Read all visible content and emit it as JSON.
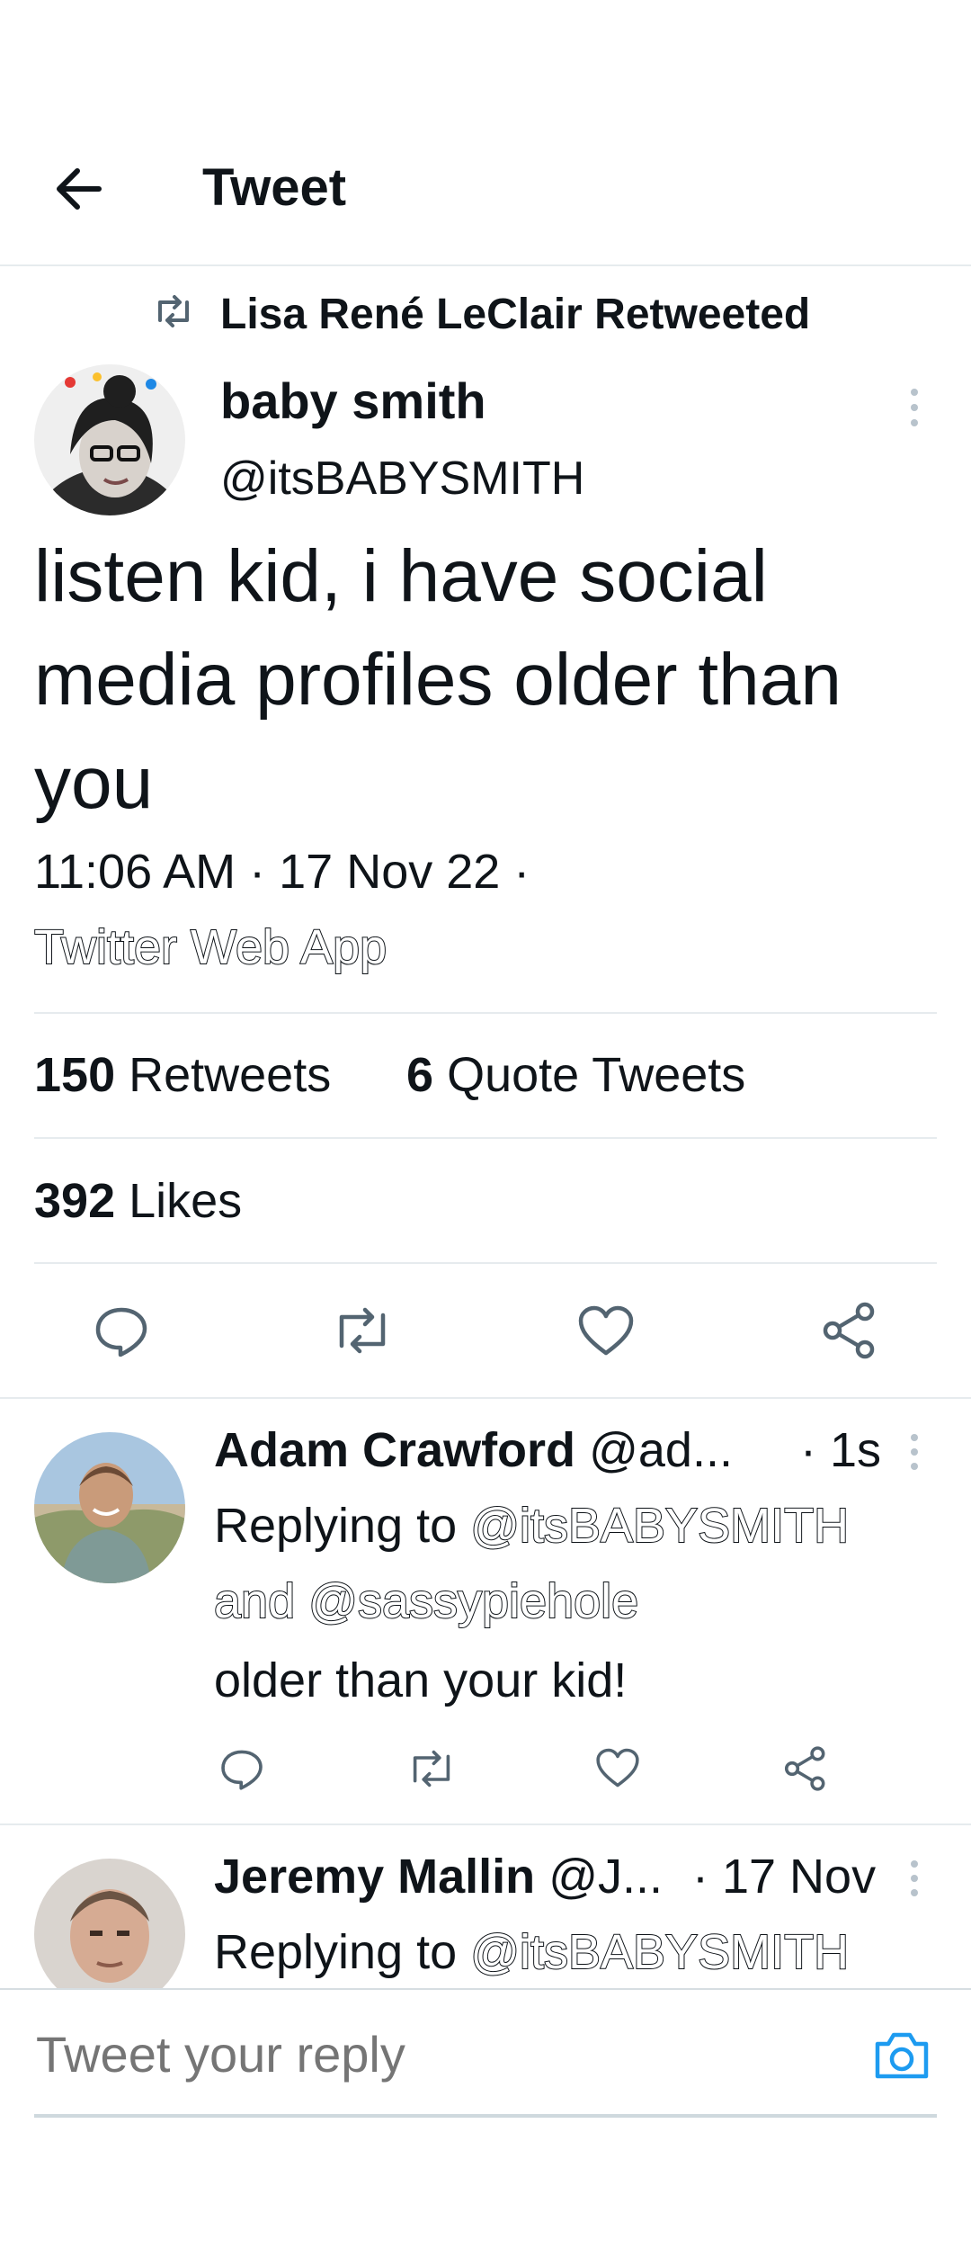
{
  "header": {
    "title": "Tweet",
    "back_icon": "arrow-left-icon"
  },
  "retweet_banner": {
    "text": "Lisa René LeClair Retweeted",
    "icon": "retweet-icon"
  },
  "tweet": {
    "author_name": "baby smith",
    "author_handle": "@itsBABYSMITH",
    "text": "listen kid, i have social media profiles older than you",
    "timestamp": "11:06 AM · 17 Nov 22 ·",
    "source": "Twitter Web App",
    "retweets_count": "150",
    "retweets_label": "Retweets",
    "quotes_count": "6",
    "quotes_label": "Quote Tweets",
    "likes_count": "392",
    "likes_label": "Likes",
    "actions": [
      "reply-icon",
      "retweet-icon",
      "like-icon",
      "share-icon"
    ]
  },
  "replies": [
    {
      "name": "Adam Crawford",
      "handle": "@ad...",
      "time": "· 1s",
      "replying_prefix": "Replying to",
      "replying_to_1": "@itsBABYSMITH",
      "replying_and": "and",
      "replying_to_2": "@sassypiehole",
      "text": "older than your kid!"
    },
    {
      "name": "Jeremy Mallin",
      "handle": "@J...",
      "time": "· 17 Nov",
      "replying_prefix": "Replying to",
      "replying_to_1": "@itsBABYSMITH"
    }
  ],
  "compose": {
    "placeholder": "Tweet your reply",
    "icon": "camera-icon"
  },
  "colors": {
    "accent": "#1d9bf0",
    "text": "#0f1419",
    "divider": "#e6ebee",
    "muted_icon": "#536471"
  }
}
